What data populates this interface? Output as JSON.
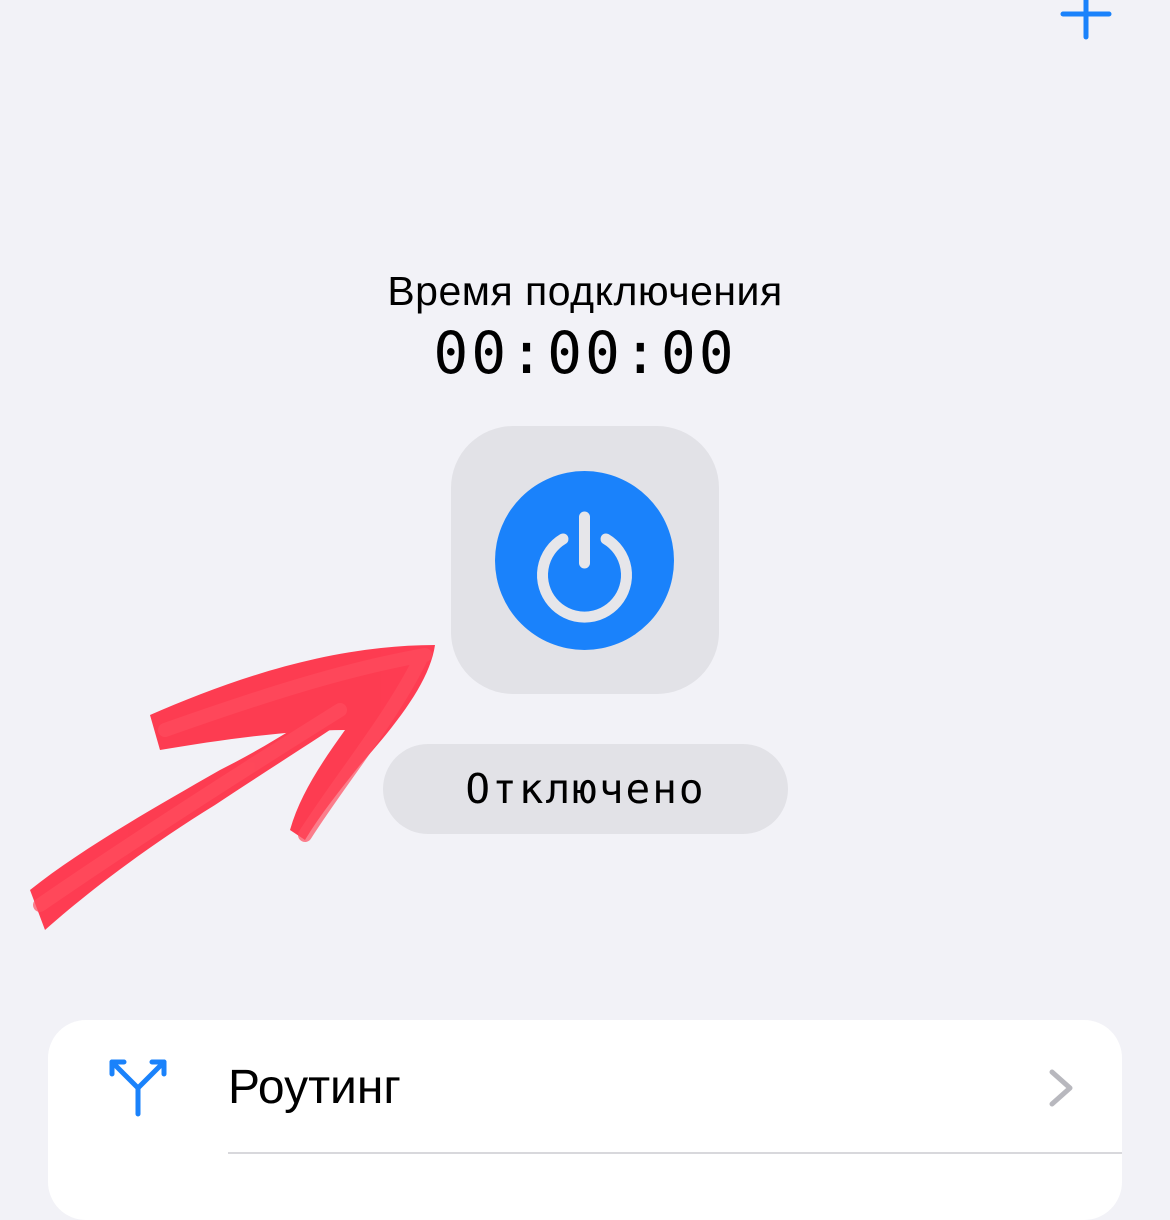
{
  "header": {
    "add_icon": "plus-icon"
  },
  "connection": {
    "time_label": "Время подключения",
    "time_value": "00:00:00",
    "power_icon": "power-icon",
    "status": "Отключено"
  },
  "settings": {
    "items": [
      {
        "label": "Роутинг",
        "icon": "routing-icon",
        "chevron": "chevron-right-icon"
      }
    ]
  },
  "colors": {
    "background": "#f2f2f7",
    "accent": "#1a82fb",
    "tile": "#e2e2e7",
    "annotation": "#ff2d43"
  }
}
